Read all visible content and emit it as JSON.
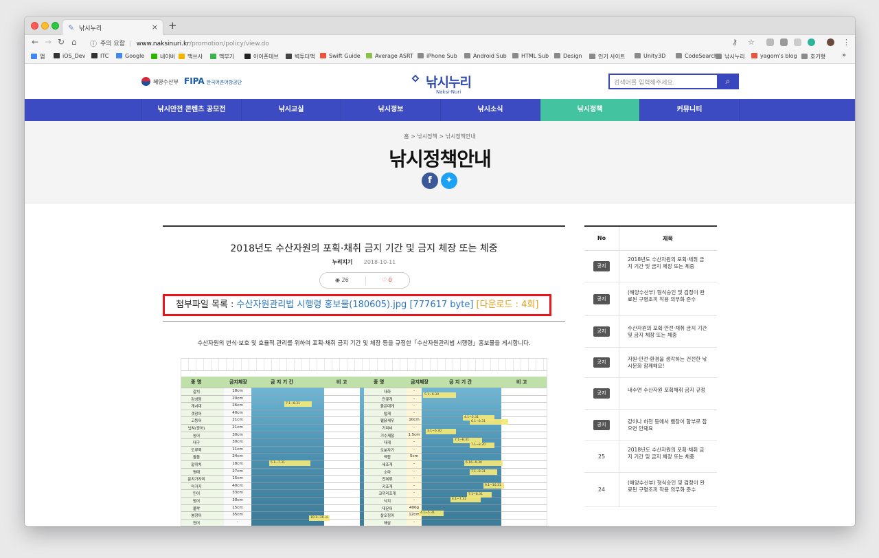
{
  "browser": {
    "tab_title": "낚시누리",
    "insecure_label": "주의 요함",
    "url_domain": "www.naksinuri.kr",
    "url_path": "/promotion/policy/view.do",
    "bookmarks": [
      {
        "label": "앱",
        "icon": "apps-icon",
        "color": "#4285f4"
      },
      {
        "label": "iOS_Dev",
        "icon": "apple-icon",
        "color": "#333333"
      },
      {
        "label": "ITC",
        "icon": "apple-icon",
        "color": "#333333"
      },
      {
        "label": "Google",
        "icon": "google-icon",
        "color": "#4285f4"
      },
      {
        "label": "네이버",
        "icon": "naver-icon",
        "color": "#2db400"
      },
      {
        "label": "맥쓰사",
        "icon": "bookmark-icon",
        "color": "#f5b400"
      },
      {
        "label": "맥부기",
        "icon": "bookmark-icon",
        "color": "#3cb44b"
      },
      {
        "label": "아이폰데브",
        "icon": "bookmark-icon",
        "color": "#222222"
      },
      {
        "label": "벽투더맥",
        "icon": "bookmark-icon",
        "color": "#444444"
      },
      {
        "label": "Swift Guide",
        "icon": "swift-icon",
        "color": "#f05138"
      },
      {
        "label": "Average ASRT",
        "icon": "bookmark-icon",
        "color": "#8bc34a"
      },
      {
        "label": "iPhone Sub",
        "icon": "folder-icon",
        "color": ""
      },
      {
        "label": "Android Sub",
        "icon": "folder-icon",
        "color": ""
      },
      {
        "label": "HTML Sub",
        "icon": "folder-icon",
        "color": ""
      },
      {
        "label": "Design",
        "icon": "folder-icon",
        "color": ""
      },
      {
        "label": "인기 사이트",
        "icon": "folder-icon",
        "color": ""
      },
      {
        "label": "Unity3D",
        "icon": "folder-icon",
        "color": ""
      },
      {
        "label": "CodeSearch",
        "icon": "folder-icon",
        "color": ""
      },
      {
        "label": "낚시누리",
        "icon": "folder-icon",
        "color": ""
      },
      {
        "label": "yagom's blog",
        "icon": "bookmark-icon",
        "color": "#e8563f"
      },
      {
        "label": "호기형",
        "icon": "folder-icon",
        "color": ""
      }
    ],
    "more_bookmarks": "»"
  },
  "header": {
    "ministry_logo": "해양수산부",
    "fipa_logo": "FIPA",
    "fipa_sub": "한국어촌어항공단",
    "site_logo": "낚시누리",
    "site_logo_en": "Naksi-Nuri",
    "search_placeholder": "검색어를 입력해주세요."
  },
  "nav": {
    "items": [
      "낚시안전 콘텐츠 공모전",
      "낚시교실",
      "낚시정보",
      "낚시소식",
      "낚시정책",
      "커뮤니티"
    ],
    "active_index": 4,
    "colors": {
      "bar": "#3c4bc2",
      "active": "#43c3a0"
    }
  },
  "hero": {
    "breadcrumb": "홈 > 낚시정책 > 낚시정책안내",
    "title": "낚시정책안내"
  },
  "article": {
    "title": "2018년도 수산자원의 포획·채취 금지 기간 및 금지 체장 또는 체중",
    "author": "누리지기",
    "date": "2018-10-11",
    "views": "26",
    "likes": "0",
    "attach_label": "첨부파일 목록 :",
    "attach_file": "수산자원관리법 시행령 홍보물(180605).jpg [777617 byte]",
    "attach_downloads": "[다운로드 : 4회]",
    "description": "수산자원의 번식·보호 및 효율적 관리를 위하여 포획·채취 금지 기간 및 체장 등을 규정한「수산자원관리법 시행령」홍보물을 게시합니다."
  },
  "poster": {
    "head_left": [
      "종 명",
      "금지체장",
      "금 지 기 간",
      "비 고"
    ],
    "head_right": [
      "종 명",
      "금지체장",
      "금 지 기 간",
      "비 고"
    ],
    "fish_left": [
      "갈치",
      "감성돔",
      "개서대",
      "갯장어",
      "고등어",
      "넙치(광어)",
      "농어",
      "대구",
      "도루묵",
      "돌돔",
      "말쥐치",
      "명태",
      "문치가자미",
      "미거지",
      "민어",
      "방어",
      "볼락",
      "붕장어",
      "연어"
    ],
    "fish_right": [
      "대하",
      "민꽃게",
      "붉은대게",
      "털게",
      "펄닭새우",
      "가리비",
      "기수재첩",
      "대게",
      "오분자기",
      "백합",
      "새조개",
      "소라",
      "전복류",
      "키조개",
      "코끼리조개",
      "낙지",
      "대문어",
      "살오징어",
      "해삼"
    ],
    "sizes_left": [
      "18cm",
      "20cm",
      "26cm",
      "40cm",
      "21cm",
      "21cm",
      "30cm",
      "30cm",
      "11cm",
      "24cm",
      "18cm",
      "27cm",
      "15cm",
      "40cm",
      "33cm",
      "30cm",
      "15cm",
      "35cm",
      "-"
    ],
    "sizes_right": [
      "-",
      "-",
      "-",
      "-",
      "10cm",
      "-",
      "1.5cm",
      "-",
      "-",
      "5cm",
      "-",
      "-",
      "-",
      "-",
      "-",
      "-",
      "400g",
      "12cm",
      "-"
    ],
    "periods": [
      "7.1~8.31",
      "5.1~6.30",
      "4.1~5.31",
      "6.1~8.31",
      "3.1~6.30",
      "7.1~8.31",
      "7.1~8.20",
      "5.1~7.31",
      "6.16~9.30",
      "7.1~8.31",
      "9.1~10.31",
      "7.1~8.31",
      "4.1~7.31",
      "4.1~5.31",
      "10.1~10.31"
    ]
  },
  "sidebar": {
    "head_no": "No",
    "head_title": "제목",
    "rows": [
      {
        "badge": "공지",
        "num": "",
        "title": "2018년도 수산자원의 포획·채취 금지 기간 및 금지 체장 또는 체중"
      },
      {
        "badge": "공지",
        "num": "",
        "title": "(해양수산부) 형식승인 및 검정이 완료된 구명조끼 착용 의무화 준수"
      },
      {
        "badge": "공지",
        "num": "",
        "title": "수산자원의 포획·안전·채취 금지 기간 및 금지 체장 또는 체중"
      },
      {
        "badge": "공지",
        "num": "",
        "title": "자원·안전·환경을 생각하는 건전한 낚시문화 함께해요!"
      },
      {
        "badge": "공지",
        "num": "",
        "title": "내수면 수산자원 포획채취 금지 규정"
      },
      {
        "badge": "공지",
        "num": "",
        "title": "강이나 하천 등에서 뱀장어 함부로 잡으면 안돼요"
      },
      {
        "badge": "",
        "num": "25",
        "title": "2018년도 수산자원의 포획·채취 금지 기간 및 금지 체장 또는 체중"
      },
      {
        "badge": "",
        "num": "24",
        "title": "(해양수산부) 형식승인 및 검정이 완료된 구명조끼 착용 의무화 준수"
      }
    ]
  }
}
